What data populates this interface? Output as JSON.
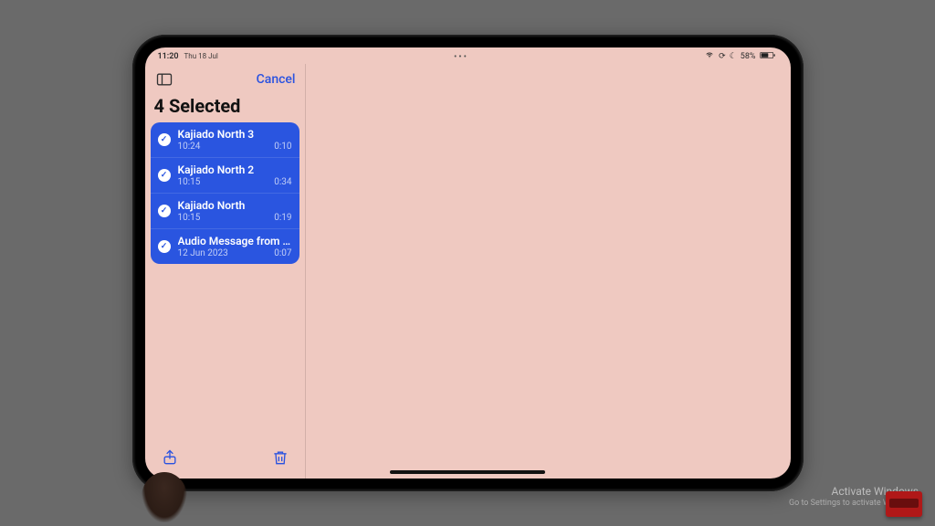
{
  "status": {
    "time": "11:20",
    "date": "Thu 18 Jul",
    "battery_pct": "58%"
  },
  "sidebar": {
    "cancel_label": "Cancel",
    "selected_title": "4 Selected"
  },
  "recordings": [
    {
      "title": "Kajiado North 3",
      "timestamp": "10:24",
      "duration": "0:10"
    },
    {
      "title": "Kajiado North 2",
      "timestamp": "10:15",
      "duration": "0:34"
    },
    {
      "title": "Kajiado North",
      "timestamp": "10:15",
      "duration": "0:19"
    },
    {
      "title": "Audio Message from Boss",
      "timestamp": "12 Jun 2023",
      "duration": "0:07"
    }
  ],
  "watermark": {
    "title": "Activate Windows",
    "sub": "Go to Settings to activate Windows."
  }
}
